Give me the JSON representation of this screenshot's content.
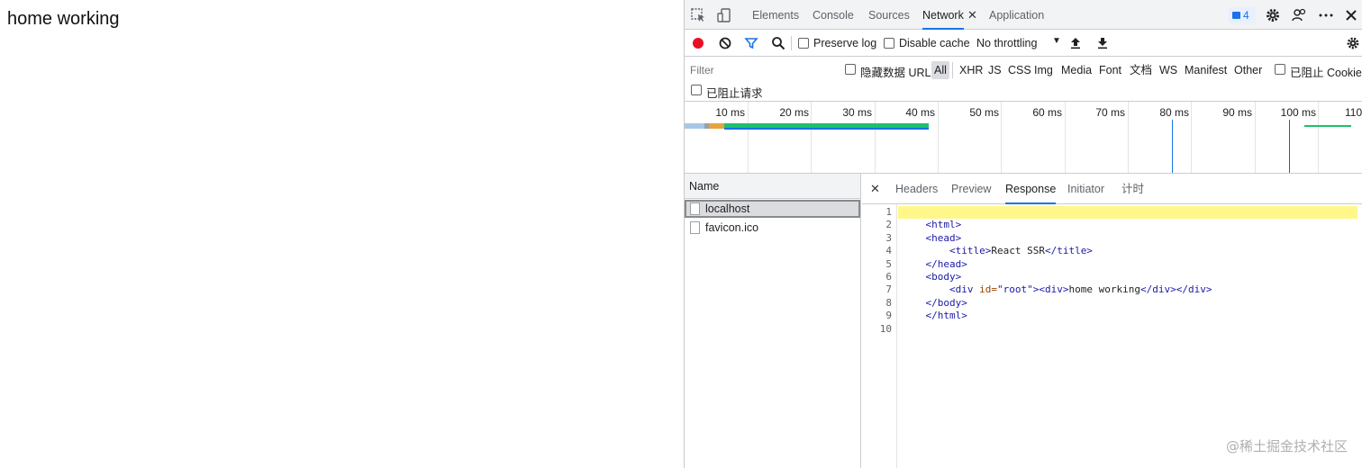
{
  "page": {
    "content_text": "home working"
  },
  "devtools": {
    "tabs": [
      {
        "label": "Elements"
      },
      {
        "label": "Console"
      },
      {
        "label": "Sources"
      },
      {
        "label": "Network",
        "active": true
      },
      {
        "label": "Application"
      }
    ],
    "message_count": "4",
    "toolbar": {
      "preserve_log": "Preserve log",
      "disable_cache": "Disable cache",
      "throttling": "No throttling"
    },
    "filter": {
      "placeholder": "Filter",
      "hide_data_urls": "隐藏数据 URL",
      "types": [
        "All",
        "XHR",
        "JS",
        "CSS",
        "Img",
        "Media",
        "Font",
        "文档",
        "WS",
        "Manifest",
        "Other"
      ],
      "blocked_cookies": "已阻止 Cookie",
      "blocked_requests": "已阻止请求"
    },
    "timeline": {
      "ticks": [
        "10 ms",
        "20 ms",
        "30 ms",
        "40 ms",
        "50 ms",
        "60 ms",
        "70 ms",
        "80 ms",
        "90 ms",
        "100 ms",
        "110"
      ],
      "colors": {
        "waiting": "#a8c7e6",
        "orange": "#e8a33c",
        "green": "#1fbf6e",
        "dom_content_loaded": "#1a73e8",
        "load": "#e81123"
      }
    },
    "requests": {
      "header": "Name",
      "items": [
        {
          "name": "localhost",
          "selected": true
        },
        {
          "name": "favicon.ico",
          "selected": false
        }
      ]
    },
    "detail": {
      "tabs": [
        {
          "label": "Headers"
        },
        {
          "label": "Preview"
        },
        {
          "label": "Response",
          "active": true
        },
        {
          "label": "Initiator"
        },
        {
          "label": "计时"
        }
      ],
      "line_numbers": [
        "1",
        "2",
        "3",
        "4",
        "5",
        "6",
        "7",
        "8",
        "9",
        "10"
      ],
      "code": {
        "l2": "<html>",
        "l3": "<head>",
        "l4_open": "<title>",
        "l4_text": "React SSR",
        "l4_close": "</title>",
        "l5": "</head>",
        "l6": "<body>",
        "l7_open": "<div",
        "l7_attr": " id=",
        "l7_val": "\"root\"",
        "l7_gt": ">",
        "l7_inner_open": "<div>",
        "l7_text": "home working",
        "l7_close": "</div></div>",
        "l8": "</body>",
        "l9": "</html>"
      }
    }
  },
  "watermark": "@稀土掘金技术社区"
}
